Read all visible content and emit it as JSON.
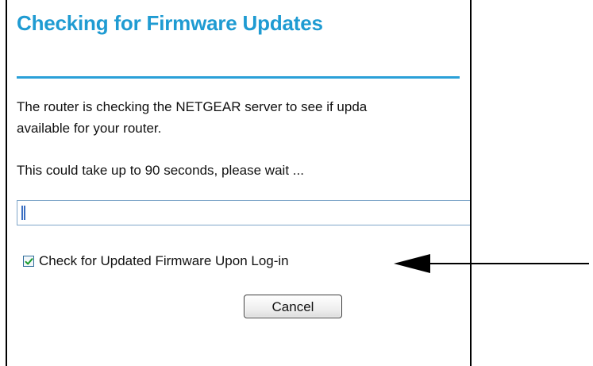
{
  "dialog": {
    "title": "Checking for Firmware Updates",
    "message_line1": "The router is checking the NETGEAR server to see if upda",
    "message_line2": "available for your router.",
    "wait_message": "This could take up to 90 seconds, please wait ...",
    "progress_icon": "progress-bar",
    "checkbox": {
      "label": "Check for Updated Firmware Upon Log-in",
      "checked": true,
      "icon": "checkmark-icon"
    },
    "cancel_label": "Cancel"
  },
  "annotation": {
    "arrow_icon": "arrow-left-icon",
    "arrow_color": "#000000"
  },
  "colors": {
    "title": "#1f9bd2",
    "divider": "#2aa0d8",
    "progress_fill": "#3b6fc2",
    "checkmark": "#1a9b2c"
  }
}
